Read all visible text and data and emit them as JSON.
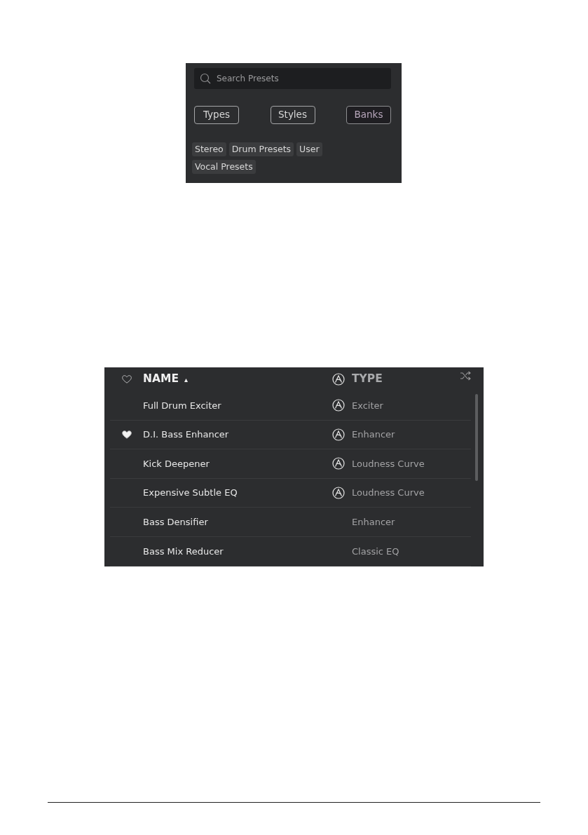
{
  "browser_panel": {
    "search": {
      "placeholder": "Search Presets"
    },
    "filter_buttons": [
      {
        "label": "Types",
        "selected": false
      },
      {
        "label": "Styles",
        "selected": false
      },
      {
        "label": "Banks",
        "selected": true
      }
    ],
    "tags": [
      "Stereo",
      "Drum Presets",
      "User",
      "Vocal Presets"
    ]
  },
  "preset_list": {
    "columns": [
      {
        "kind": "favorite"
      },
      {
        "kind": "name",
        "label": "NAME",
        "sort": "▴"
      },
      {
        "kind": "factory"
      },
      {
        "kind": "type",
        "label": "TYPE"
      },
      {
        "kind": "shuffle"
      }
    ],
    "rows": [
      {
        "favorite": false,
        "factory": true,
        "name": "Full Drum Exciter",
        "type": "Exciter"
      },
      {
        "favorite": true,
        "factory": true,
        "name": "D.I. Bass Enhancer",
        "type": "Enhancer"
      },
      {
        "favorite": false,
        "factory": true,
        "name": "Kick Deepener",
        "type": "Loudness Curve"
      },
      {
        "favorite": false,
        "factory": true,
        "name": "Expensive Subtle EQ",
        "type": "Loudness Curve"
      },
      {
        "favorite": false,
        "factory": false,
        "name": "Bass Densifier",
        "type": "Enhancer"
      },
      {
        "favorite": false,
        "factory": false,
        "name": "Bass Mix Reducer",
        "type": "Classic EQ"
      }
    ]
  }
}
